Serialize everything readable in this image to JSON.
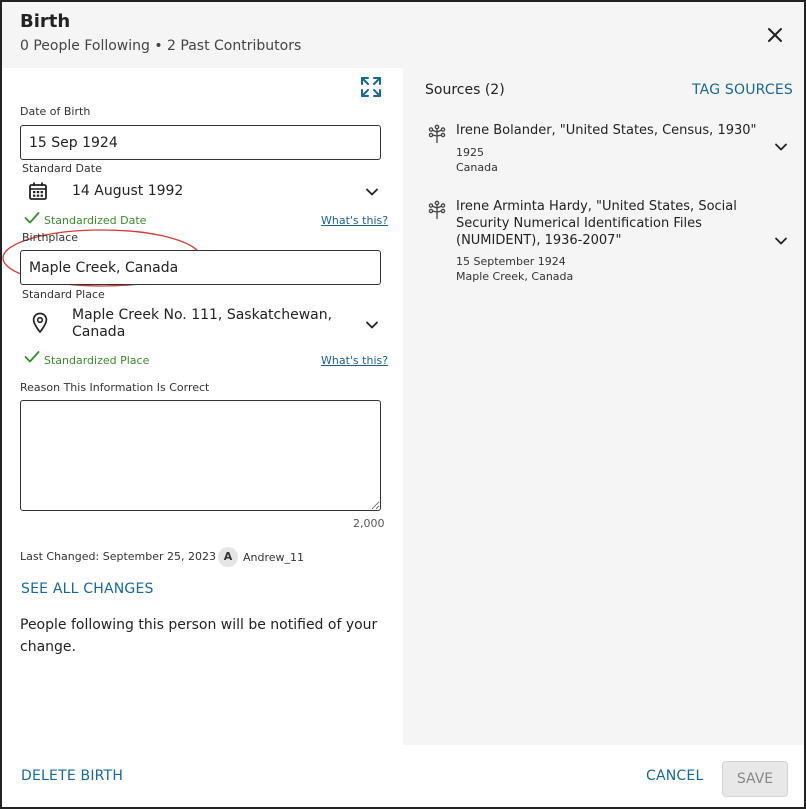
{
  "header": {
    "title": "Birth",
    "subtitle": "0 People Following • 2 Past Contributors"
  },
  "form": {
    "date_label": "Date of Birth",
    "date_value": "15 Sep 1924",
    "standard_date_label": "Standard Date",
    "standard_date_value": "14 August 1992",
    "standardized_date_text": "Standardized Date",
    "whats_this_1": "What's this?",
    "birthplace_label": "Birthplace",
    "birthplace_value": "Maple Creek, Canada",
    "standard_place_label": "Standard Place",
    "standard_place_line1": "Maple Creek No. 111, Saskatchewan,",
    "standard_place_line2": "Canada",
    "standardized_place_text": "Standardized Place",
    "whats_this_2": "What's this?",
    "reason_label": "Reason This Information Is Correct",
    "reason_value": "",
    "char_count": "2,000",
    "last_changed": "Last Changed: September 25, 2023",
    "avatar_initial": "A",
    "username": "Andrew_11",
    "see_all_changes": "SEE ALL CHANGES",
    "notice": "People following this person will be notified of your change."
  },
  "sources": {
    "heading": "Sources (2)",
    "tag_sources": "TAG SOURCES",
    "items": [
      {
        "title": "Irene Bolander, \"United States, Census, 1930\"",
        "date": "1925",
        "place": "Canada"
      },
      {
        "title_line1": "Irene Arminta Hardy, \"United States, Social",
        "title_line2": "Security Numerical Identification Files",
        "title_line3": "(NUMIDENT), 1936-2007\"",
        "date": "15 September 1924",
        "place": "Maple Creek, Canada"
      }
    ]
  },
  "footer": {
    "delete": "DELETE BIRTH",
    "cancel": "CANCEL",
    "save": "SAVE"
  },
  "icons": {
    "close": "close-icon",
    "expand": "expand-icon",
    "calendar": "calendar-icon",
    "pin": "location-pin-icon",
    "tree": "family-tree-icon",
    "chevron": "chevron-down-icon",
    "check": "checkmark-icon"
  },
  "colors": {
    "accent_link": "#1a6890",
    "success": "#3c8a2e",
    "annotation_ring": "#d23b3b",
    "panel_bg": "#f5f5f5"
  }
}
